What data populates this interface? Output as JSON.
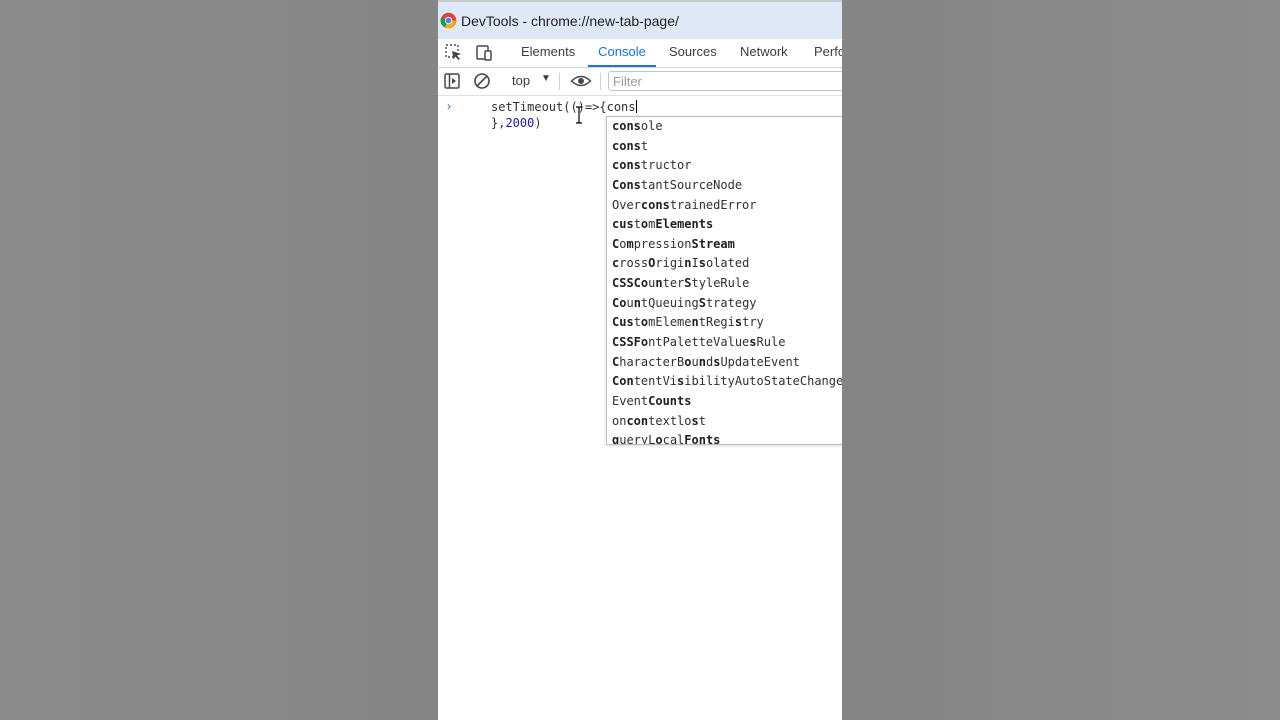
{
  "window": {
    "title": "DevTools - chrome://new-tab-page/"
  },
  "tabs": [
    {
      "label": "Elements"
    },
    {
      "label": "Console"
    },
    {
      "label": "Sources"
    },
    {
      "label": "Network"
    },
    {
      "label": "Perfo"
    }
  ],
  "active_tab": "Console",
  "toolbar": {
    "context": "top",
    "filter_placeholder": "Filter"
  },
  "console": {
    "prompt": "›",
    "line1_prefix": "setTimeout(",
    "line1_paren": "()",
    "line1_rest": "=>{cons",
    "line2_brace": "},",
    "line2_number": "2000",
    "line2_close": ")"
  },
  "autocomplete": {
    "items": [
      {
        "bold": "cons",
        "rest": "ole"
      },
      {
        "bold": "cons",
        "rest": "t"
      },
      {
        "bold": "cons",
        "rest": "tructor"
      },
      {
        "bold": "Cons",
        "rest": "tantSourceNode"
      },
      {
        "pre": "Over",
        "bold": "cons",
        "rest": "trainedError"
      },
      {
        "html_parts": [
          [
            "b",
            "cus"
          ],
          [
            "",
            "t"
          ],
          [
            "b",
            "o"
          ],
          [
            "",
            "m"
          ],
          [
            "b",
            "Elements"
          ]
        ],
        "text": "customElements"
      },
      {
        "html_parts": [
          [
            "b",
            "C"
          ],
          [
            "",
            "o"
          ],
          [
            "b",
            "m"
          ],
          [
            "",
            "pression"
          ],
          [
            "b",
            "Stream"
          ]
        ],
        "text": "CompressionStream"
      },
      {
        "html_parts": [
          [
            "b",
            "c"
          ],
          [
            "",
            "ross"
          ],
          [
            "b",
            "O"
          ],
          [
            "",
            "rigi"
          ],
          [
            "b",
            "n"
          ],
          [
            "",
            "I"
          ],
          [
            "b",
            "s"
          ],
          [
            "",
            "olated"
          ]
        ],
        "text": "crossOriginIsolated"
      },
      {
        "html_parts": [
          [
            "b",
            "CSSCo"
          ],
          [
            "",
            "u"
          ],
          [
            "b",
            "n"
          ],
          [
            "",
            "ter"
          ],
          [
            "b",
            "S"
          ],
          [
            "",
            "tyleRule"
          ]
        ],
        "text": "CSSCounterStyleRule"
      },
      {
        "html_parts": [
          [
            "b",
            "Co"
          ],
          [
            "",
            "u"
          ],
          [
            "b",
            "n"
          ],
          [
            "",
            "tQueuing"
          ],
          [
            "b",
            "S"
          ],
          [
            "",
            "trategy"
          ]
        ],
        "text": "CountQueuingStrategy"
      },
      {
        "html_parts": [
          [
            "b",
            "Cus"
          ],
          [
            "",
            "t"
          ],
          [
            "b",
            "o"
          ],
          [
            "",
            "mEleme"
          ],
          [
            "b",
            "n"
          ],
          [
            "",
            "tRegi"
          ],
          [
            "b",
            "s"
          ],
          [
            "",
            "try"
          ]
        ],
        "text": "CustomElementRegistry"
      },
      {
        "html_parts": [
          [
            "b",
            "CSSFo"
          ],
          [
            "",
            "ntPaletteValue"
          ],
          [
            "b",
            "s"
          ],
          [
            "",
            "Rule"
          ]
        ],
        "text": "CSSFontPaletteValuesRule"
      },
      {
        "html_parts": [
          [
            "b",
            "C"
          ],
          [
            "",
            "haracterB"
          ],
          [
            "b",
            "o"
          ],
          [
            "",
            "u"
          ],
          [
            "b",
            "n"
          ],
          [
            "",
            "d"
          ],
          [
            "b",
            "s"
          ],
          [
            "",
            "UpdateEvent"
          ]
        ],
        "text": "CharacterBoundsUpdateEvent"
      },
      {
        "html_parts": [
          [
            "b",
            "Con"
          ],
          [
            "",
            "tentVi"
          ],
          [
            "b",
            "s"
          ],
          [
            "",
            "ibilityAutoStateChange"
          ]
        ],
        "text": "ContentVisibilityAutoStateChange"
      },
      {
        "html_parts": [
          [
            "",
            "Event"
          ],
          [
            "b",
            "Counts"
          ]
        ],
        "text": "EventCounts"
      },
      {
        "html_parts": [
          [
            "",
            "on"
          ],
          [
            "b",
            "con"
          ],
          [
            "",
            "textlo"
          ],
          [
            "b",
            "s"
          ],
          [
            "",
            "t"
          ]
        ],
        "text": "oncontextlost"
      },
      {
        "html_parts": [
          [
            "b",
            "q"
          ],
          [
            "",
            "ueryL"
          ],
          [
            "b",
            "o"
          ],
          [
            "",
            "cal"
          ],
          [
            "b",
            "Fonts"
          ]
        ],
        "text": "queryLocalFonts"
      }
    ]
  },
  "colors": {
    "accent": "#1a73e8",
    "titlebar": "#dfe8f6",
    "number": "#1a1aa6"
  },
  "icons": [
    "chrome-logo-icon",
    "inspect-element-icon",
    "device-toolbar-icon",
    "sidebar-toggle-icon",
    "clear-console-icon",
    "dropdown-arrow-icon",
    "eye-icon",
    "text-cursor-icon"
  ]
}
